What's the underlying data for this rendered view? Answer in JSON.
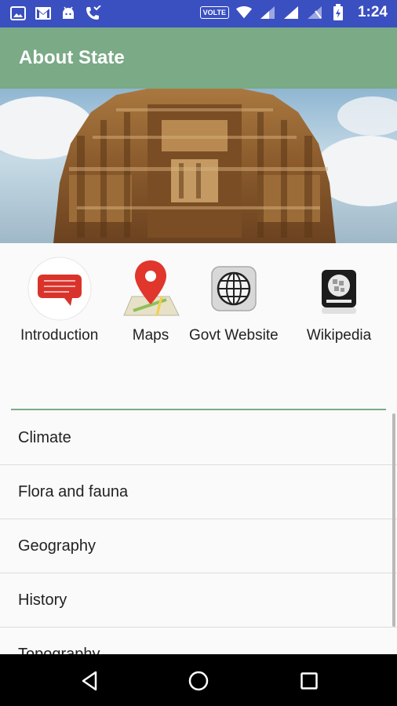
{
  "status_bar": {
    "left_icons": [
      "image-icon",
      "gmail-icon",
      "android-icon",
      "missed-call-icon"
    ],
    "volte_label": "VOLTE",
    "time": "1:24"
  },
  "app_bar": {
    "title": "About State"
  },
  "shortcuts": [
    {
      "label": "Introduction",
      "icon": "chat-bubble-icon"
    },
    {
      "label": "Maps",
      "icon": "map-pin-icon"
    },
    {
      "label": "Govt Website",
      "icon": "globe-icon"
    },
    {
      "label": "Wikipedia",
      "icon": "wikipedia-icon"
    }
  ],
  "topics": [
    "Climate",
    "Flora and fauna",
    "Geography",
    "History",
    "Topography"
  ],
  "colors": {
    "status_bar": "#3a4fc0",
    "app_bar": "#7aaa86",
    "accent": "#7aaa86",
    "chat_red": "#d9342b",
    "pin_red": "#e0362c"
  }
}
